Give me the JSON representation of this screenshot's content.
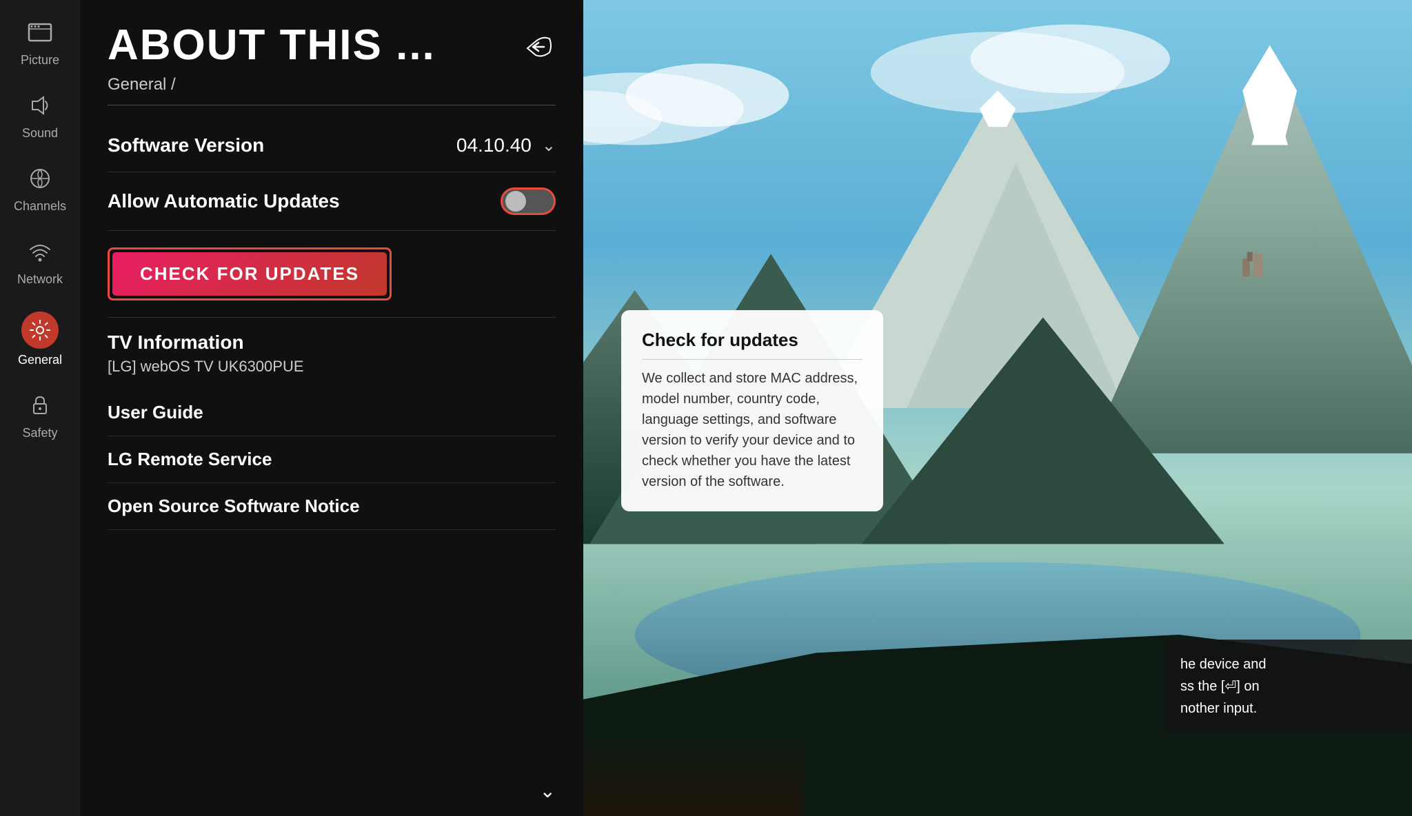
{
  "sidebar": {
    "items": [
      {
        "id": "picture",
        "label": "Picture",
        "icon": "⊞",
        "active": false
      },
      {
        "id": "sound",
        "label": "Sound",
        "icon": "🔈",
        "active": false
      },
      {
        "id": "channels",
        "label": "Channels",
        "icon": "♟",
        "active": false
      },
      {
        "id": "network",
        "label": "Network",
        "icon": "⊕",
        "active": false
      },
      {
        "id": "general",
        "label": "General",
        "icon": "⚙",
        "active": true
      },
      {
        "id": "safety",
        "label": "Safety",
        "icon": "🔒",
        "active": false
      }
    ]
  },
  "main": {
    "page_title": "ABOUT THIS ...",
    "breadcrumb": "General /",
    "software_version_label": "Software Version",
    "software_version_value": "04.10.40",
    "auto_updates_label": "Allow Automatic Updates",
    "check_updates_btn": "CHECK FOR UPDATES",
    "tv_info_title": "TV Information",
    "tv_info_model": "[LG] webOS TV UK6300PUE",
    "user_guide_label": "User Guide",
    "remote_service_label": "LG Remote Service",
    "open_source_label": "Open Source Software Notice"
  },
  "tooltip": {
    "title": "Check for updates",
    "text": "We collect and store MAC address, model number, country code, language settings, and software version to verify your device and to check whether you have the latest version of the software."
  },
  "overlay": {
    "text": "he device and\nss the [⏎] on\nnother input."
  }
}
